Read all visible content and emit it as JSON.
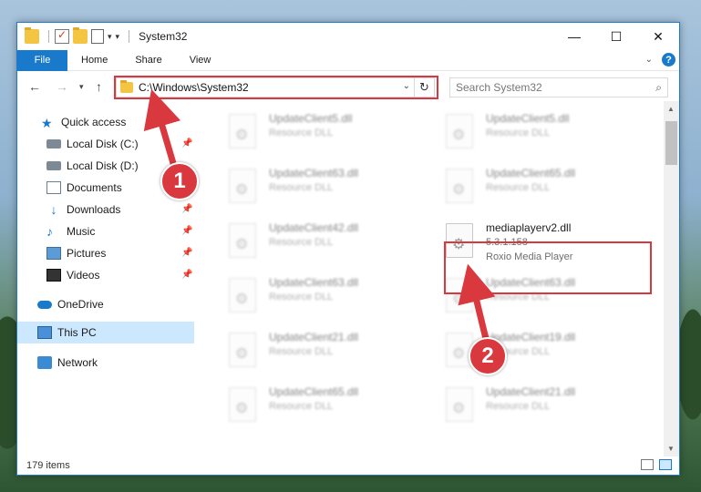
{
  "window": {
    "title": "System32",
    "controls": {
      "minimize": "—",
      "maximize": "☐",
      "close": "✕"
    }
  },
  "ribbon": {
    "tabs": [
      "File",
      "Home",
      "Share",
      "View"
    ],
    "expand_chevron": "⌄",
    "help": "?"
  },
  "address_bar": {
    "path": "C:\\Windows\\System32",
    "search_placeholder": "Search System32"
  },
  "sidebar": {
    "quick_access": "Quick access",
    "items": [
      {
        "label": "Local Disk (C:)",
        "icon": "disk-icon",
        "pinned": true
      },
      {
        "label": "Local Disk (D:)",
        "icon": "disk-icon",
        "pinned": false
      },
      {
        "label": "Documents",
        "icon": "documents-icon",
        "pinned": true
      },
      {
        "label": "Downloads",
        "icon": "downloads-icon",
        "pinned": true
      },
      {
        "label": "Music",
        "icon": "music-icon",
        "pinned": true
      },
      {
        "label": "Pictures",
        "icon": "pictures-icon",
        "pinned": true
      },
      {
        "label": "Videos",
        "icon": "videos-icon",
        "pinned": true
      }
    ],
    "onedrive": "OneDrive",
    "this_pc": "This PC",
    "network": "Network"
  },
  "files": [
    {
      "name": "UpdateClient5.dll",
      "desc": "Resource DLL"
    },
    {
      "name": "UpdateClient5.dll",
      "desc": "Resource DLL"
    },
    {
      "name": "UpdateClient63.dll",
      "desc": "Resource DLL"
    },
    {
      "name": "UpdateClient65.dll",
      "desc": "Resource DLL"
    },
    {
      "name": "UpdateClient42.dll",
      "desc": "Resource DLL"
    },
    {
      "name": "mediaplayerv2.dll",
      "version": "5.3.1.158",
      "desc": "Roxio Media Player"
    },
    {
      "name": "UpdateClient63.dll",
      "desc": "Resource DLL"
    },
    {
      "name": "UpdateClient63.dll",
      "desc": "Resource DLL"
    },
    {
      "name": "UpdateClient21.dll",
      "desc": "Resource DLL"
    },
    {
      "name": "UpdateClient19.dll",
      "desc": "Resource DLL"
    },
    {
      "name": "UpdateClient65.dll",
      "desc": "Resource DLL"
    },
    {
      "name": "UpdateClient21.dll",
      "desc": "Resource DLL"
    }
  ],
  "status": {
    "item_count": "179 items"
  },
  "annotations": {
    "step1": "1",
    "step2": "2",
    "color": "#d9393e"
  }
}
